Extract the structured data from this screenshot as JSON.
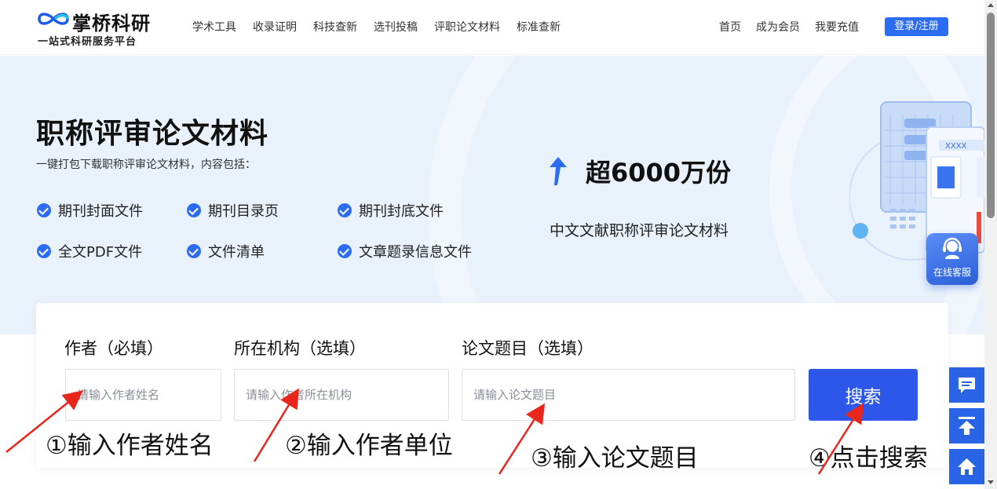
{
  "header": {
    "brand": "掌桥科研",
    "slogan": "一站式科研服务平台",
    "nav": [
      "学术工具",
      "收录证明",
      "科技查新",
      "选刊投稿",
      "评职论文材料",
      "标准查新"
    ],
    "nav_right": [
      "首页",
      "成为会员",
      "我要充值"
    ],
    "login": "登录/注册"
  },
  "hero": {
    "title": "职称评审论文材料",
    "subtitle": "一键打包下载职称评审论文材料，内容包括：",
    "features": [
      "期刊封面文件",
      "期刊目录页",
      "期刊封底文件",
      "全文PDF文件",
      "文件清单",
      "文章题录信息文件"
    ],
    "stat_value": "超6000万份",
    "stat_desc": "中文文献职称评审论文材料",
    "illus_tag": "XXXX"
  },
  "customer_service": {
    "label": "在线客服"
  },
  "search": {
    "author_label": "作者（必填）",
    "author_placeholder": "请输入作者姓名",
    "org_label": "所在机构（选填）",
    "org_placeholder": "请输入作者所在机构",
    "title_label": "论文题目（选填）",
    "title_placeholder": "请输入论文题目",
    "button": "搜索"
  },
  "annotations": [
    "①输入作者姓名",
    "②输入作者单位",
    "③输入论文题目",
    "④点击搜索"
  ],
  "colors": {
    "accent": "#2c6cf0",
    "search_button": "#2c57e8",
    "hero_bg": "#e9f1fb",
    "annotation_arrow": "#e8261b"
  },
  "toolbar_icons": [
    "message-icon",
    "back-to-top-icon",
    "home-icon"
  ]
}
